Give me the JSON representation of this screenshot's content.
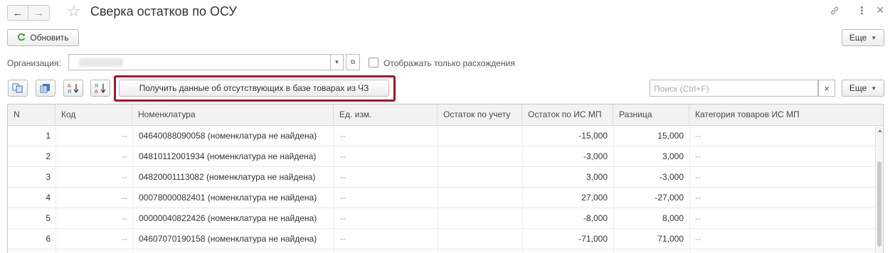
{
  "window": {
    "title": "Сверка остатков по ОСУ",
    "back_icon": "←",
    "forward_icon": "→",
    "star_icon": "☆",
    "link_icon": "🔗",
    "more_icon": "⋮",
    "close_icon": "×"
  },
  "toolbar": {
    "refresh_icon": "C",
    "refresh_label": "Обновить",
    "more_label": "Еще"
  },
  "filters": {
    "org_label": "Организация:",
    "org_dropdown_icon": "▾",
    "org_open_icon": "⧉",
    "only_diff_label": "Отображать только расхождения"
  },
  "table_toolbar": {
    "get_data_label": "Получить данные об отсутствующих в базе товарах из ЧЗ",
    "search_placeholder": "Поиск (Ctrl+F)",
    "search_clear_icon": "×",
    "more_label": "Еще"
  },
  "colors": {
    "highlight": "#a0182a",
    "refresh_icon": "#3a9a3a"
  },
  "table": {
    "columns": [
      "N",
      "Код",
      "Номенклатура",
      "Ед. изм.",
      "Остаток по учету",
      "Остаток по ИС МП",
      "Разница",
      "Категория товаров ИС МП"
    ],
    "rows": [
      {
        "n": "1",
        "code": "--",
        "item": "04640088090058 (номенклатура не найдена)",
        "unit": "--",
        "acc": "",
        "ismp": "-15,000",
        "diff": "15,000",
        "cat": "--"
      },
      {
        "n": "2",
        "code": "--",
        "item": "04810112001934 (номенклатура не найдена)",
        "unit": "--",
        "acc": "",
        "ismp": "-3,000",
        "diff": "3,000",
        "cat": "--"
      },
      {
        "n": "3",
        "code": "--",
        "item": "04820001113082 (номенклатура не найдена)",
        "unit": "--",
        "acc": "",
        "ismp": "3,000",
        "diff": "-3,000",
        "cat": "--"
      },
      {
        "n": "4",
        "code": "--",
        "item": "00078000082401 (номенклатура не найдена)",
        "unit": "--",
        "acc": "",
        "ismp": "27,000",
        "diff": "-27,000",
        "cat": "--"
      },
      {
        "n": "5",
        "code": "--",
        "item": "00000040822426 (номенклатура не найдена)",
        "unit": "--",
        "acc": "",
        "ismp": "-8,000",
        "diff": "8,000",
        "cat": "--"
      },
      {
        "n": "6",
        "code": "--",
        "item": "04607070190158 (номенклатура не найдена)",
        "unit": "--",
        "acc": "",
        "ismp": "-71,000",
        "diff": "71,000",
        "cat": "--"
      }
    ]
  }
}
